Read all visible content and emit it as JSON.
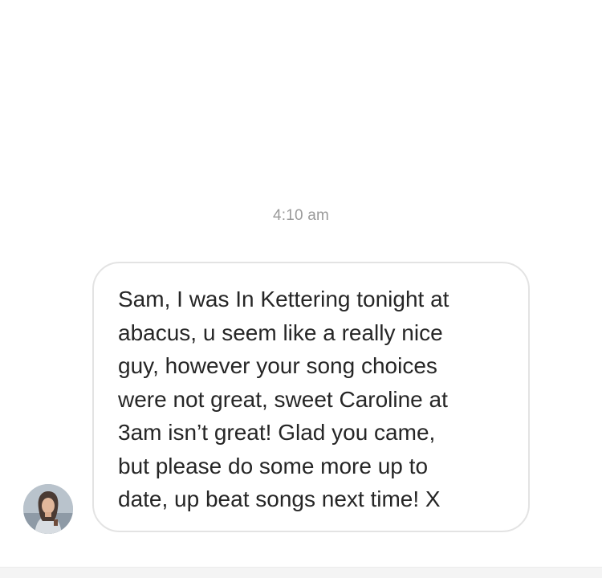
{
  "thread": {
    "timestamp": "4:10 am",
    "message": {
      "sender_avatar_icon": "profile-photo",
      "text": "Sam, I was In Kettering tonight at\nabacus, u seem like a really nice\nguy, however your song choices\nwere not great, sweet Caroline at\n3am isn’t great! Glad you came,\nbut please do some more up to\ndate, up beat songs next time! X"
    }
  },
  "colors": {
    "background": "#ffffff",
    "bubble_border": "#e3e3e3",
    "message_text": "#262626",
    "timestamp_text": "#9a9a9a"
  }
}
